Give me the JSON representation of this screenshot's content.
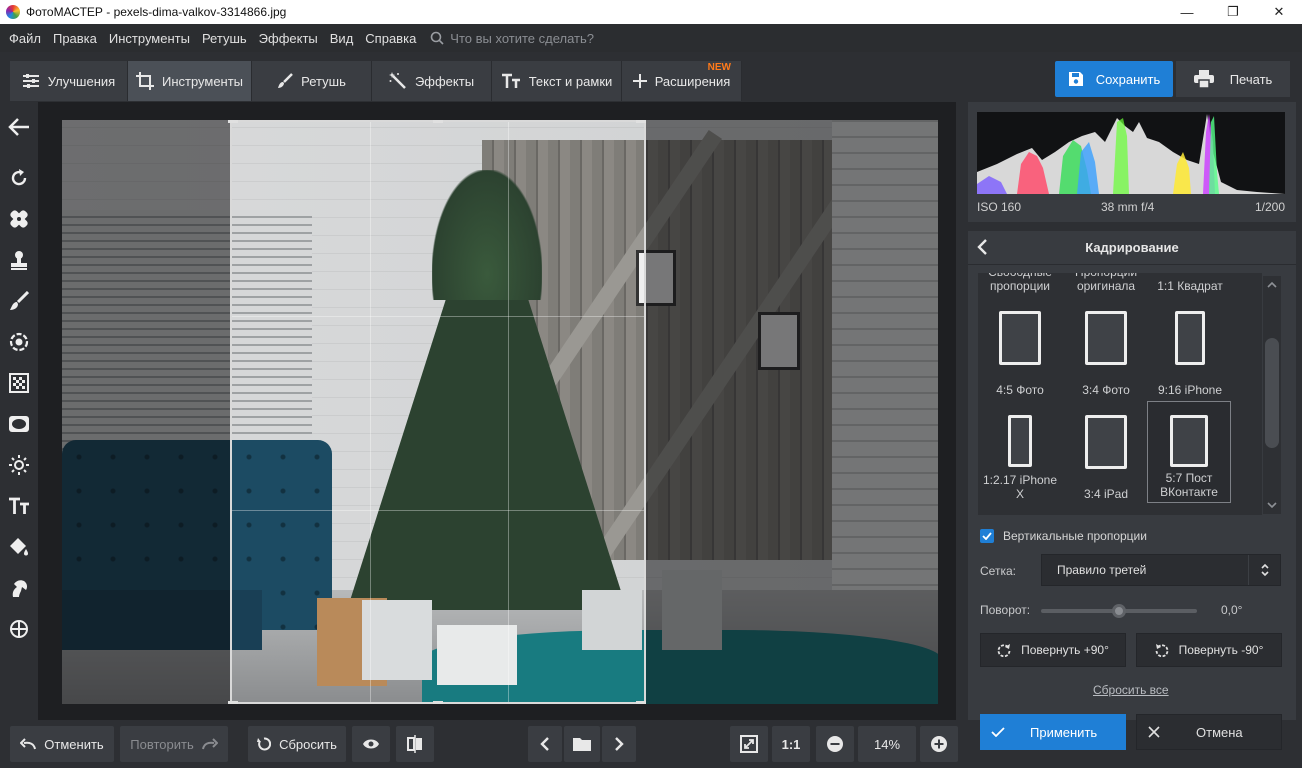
{
  "window": {
    "title": "ФотоМАСТЕР - pexels-dima-valkov-3314866.jpg",
    "min_glyph": "—",
    "max_glyph": "❐",
    "close_glyph": "✕"
  },
  "menu": {
    "items": [
      "Файл",
      "Правка",
      "Инструменты",
      "Ретушь",
      "Эффекты",
      "Вид",
      "Справка"
    ],
    "search_placeholder": "Что вы хотите сделать?"
  },
  "tabs": [
    {
      "label": "Улучшения",
      "icon": "sliders-icon",
      "active": false
    },
    {
      "label": "Инструменты",
      "icon": "crop-icon",
      "active": true
    },
    {
      "label": "Ретушь",
      "icon": "brush-icon",
      "active": false
    },
    {
      "label": "Эффекты",
      "icon": "magic-wand-icon",
      "active": false
    },
    {
      "label": "Текст и рамки",
      "icon": "text-icon",
      "active": false
    },
    {
      "label": "Расширения",
      "icon": "plus-icon",
      "active": false,
      "badge": "NEW"
    }
  ],
  "header_actions": {
    "save": "Сохранить",
    "print": "Печать"
  },
  "colors": {
    "accent": "#1f7fd6",
    "badge": "#ff7a1a"
  },
  "left_tools": [
    "back-arrow-icon",
    "rotate-icon",
    "patch-icon",
    "stamp-icon",
    "brush-icon",
    "target-icon",
    "grid-icon",
    "vignette-icon",
    "light-icon",
    "text-icon",
    "fill-icon",
    "horse-icon",
    "crosshair-icon"
  ],
  "histogram": {
    "iso": "ISO 160",
    "lens": "38 mm f/4",
    "shutter": "1/200"
  },
  "panel": {
    "title": "Кадрирование",
    "presets_top": [
      "Свободные пропорции",
      "Пропорции оригинала",
      "1:1 Квадрат"
    ],
    "presets": [
      {
        "label": "4:5 Фото",
        "selected": false
      },
      {
        "label": "3:4 Фото",
        "selected": false
      },
      {
        "label": "9:16 iPhone",
        "selected": false
      },
      {
        "label": "1:2.17 iPhone X",
        "selected": false
      },
      {
        "label": "3:4 iPad",
        "selected": false
      },
      {
        "label": "5:7 Пост ВКонтакте",
        "selected": true
      }
    ],
    "vertical_label": "Вертикальные пропорции",
    "vertical_checked": true,
    "grid_label": "Сетка:",
    "grid_value": "Правило третей",
    "rotation_label": "Поворот:",
    "rotation_value": "0,0°",
    "rotation_level": 0.5,
    "rotate_plus": "Повернуть +90°",
    "rotate_minus": "Повернуть -90°",
    "reset_all": "Сбросить все",
    "apply": "Применить",
    "cancel": "Отмена"
  },
  "bottom": {
    "undo": "Отменить",
    "redo": "Повторить",
    "reset": "Сбросить",
    "zoom_fit": "1:1",
    "zoom": "14%"
  }
}
